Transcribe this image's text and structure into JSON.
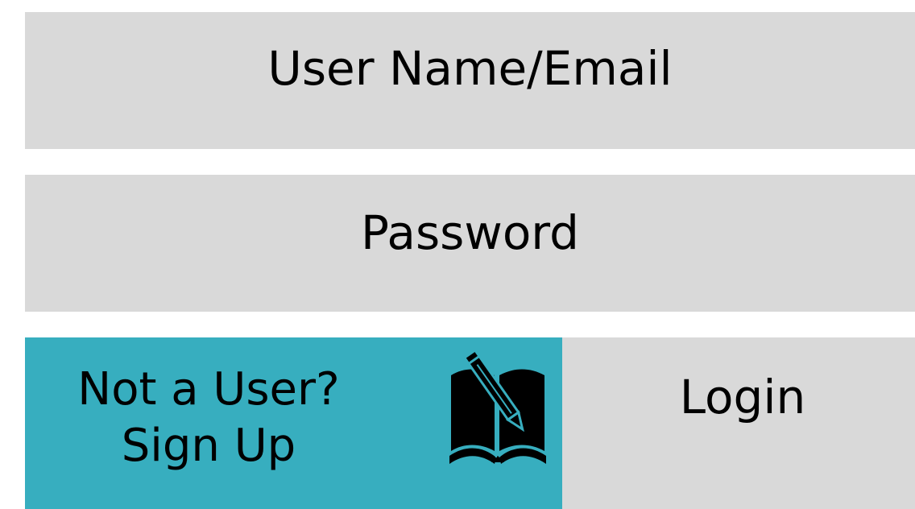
{
  "form": {
    "username_placeholder": "User Name/Email",
    "password_placeholder": "Password",
    "signup_line1": "Not a User?",
    "signup_line2": "Sign Up",
    "signup_icon": "book-pencil-icon",
    "login_label": "Login"
  },
  "colors": {
    "field_bg": "#d9d9d9",
    "signup_bg": "#37aebf",
    "text": "#000000"
  }
}
